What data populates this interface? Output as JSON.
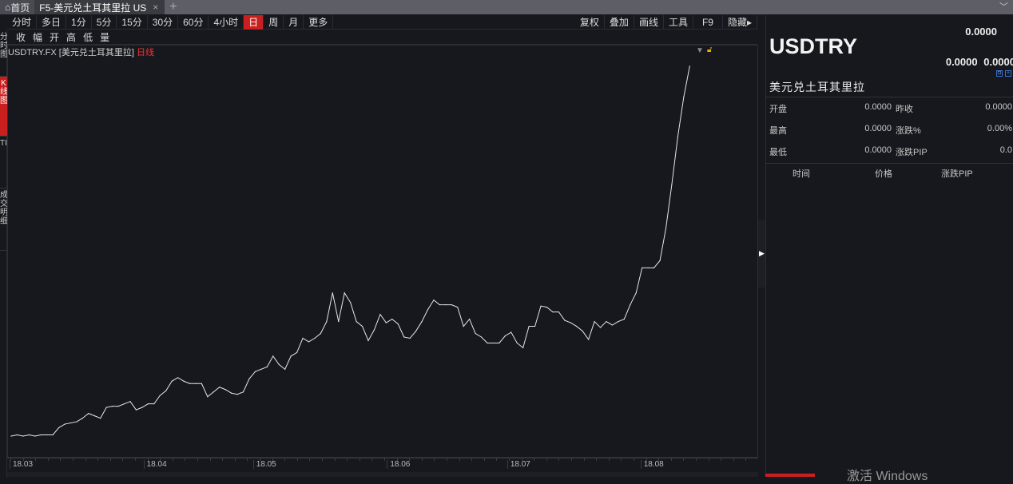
{
  "tabs": {
    "home": "首页",
    "active": "F5-美元兑土耳其里拉 US",
    "close": "×",
    "add": "+"
  },
  "toolbar": {
    "periods": [
      "分时",
      "多日",
      "1分",
      "5分",
      "15分",
      "30分",
      "60分",
      "4小时",
      "日",
      "周",
      "月",
      "更多"
    ],
    "active_period": "日",
    "right": [
      "复权",
      "叠加",
      "画线",
      "工具",
      "F9",
      "隐藏▸"
    ]
  },
  "indicators": [
    "收",
    "幅",
    "开",
    "高",
    "低",
    "量"
  ],
  "sidebar": [
    "分时图",
    "K线图",
    "TICK",
    "成交明细"
  ],
  "chart_header": {
    "symbol": "USDTRY.FX",
    "name": "[美元兑土耳其里拉]",
    "period": "日线"
  },
  "quote": {
    "symbol": "USDTRY",
    "name": "美元兑土耳其里拉",
    "last": "0.0000",
    "bid": "0.0000",
    "ask": "0.0000",
    "rows": [
      {
        "l1": "开盘",
        "v1": "0.0000",
        "l2": "昨收",
        "v2": "0.0000"
      },
      {
        "l1": "最高",
        "v1": "0.0000",
        "l2": "涨跌%",
        "v2": "0.00%"
      },
      {
        "l1": "最低",
        "v1": "0.0000",
        "l2": "涨跌PIP",
        "v2": "0.0"
      }
    ],
    "columns": [
      "时间",
      "价格",
      "涨跌PIP"
    ]
  },
  "watermark": "激活 Windows",
  "colors": {
    "accent": "#c9201f",
    "line": "#e6e6e6",
    "background": "#16181d"
  },
  "chart_data": {
    "type": "line",
    "title": "USDTRY.FX 日线",
    "xlabel": "",
    "ylabel": "",
    "ylim": [
      3.8,
      6.9
    ],
    "x_ticks": [
      {
        "index": 0,
        "label": "18.03"
      },
      {
        "index": 22.5,
        "label": "18.04"
      },
      {
        "index": 40.9,
        "label": "18.05"
      },
      {
        "index": 63.4,
        "label": "18.06"
      },
      {
        "index": 83.6,
        "label": "18.07"
      },
      {
        "index": 106,
        "label": "18.08"
      }
    ],
    "values": [
      3.8,
      3.81,
      3.8,
      3.81,
      3.8,
      3.81,
      3.81,
      3.81,
      3.87,
      3.9,
      3.91,
      3.92,
      3.95,
      3.99,
      3.97,
      3.95,
      4.04,
      4.05,
      4.05,
      4.07,
      4.09,
      4.02,
      4.04,
      4.07,
      4.07,
      4.14,
      4.18,
      4.26,
      4.29,
      4.26,
      4.24,
      4.24,
      4.24,
      4.13,
      4.17,
      4.21,
      4.19,
      4.16,
      4.15,
      4.17,
      4.28,
      4.34,
      4.36,
      4.38,
      4.47,
      4.4,
      4.36,
      4.47,
      4.5,
      4.62,
      4.59,
      4.62,
      4.66,
      4.76,
      5.0,
      4.76,
      5.0,
      4.92,
      4.76,
      4.72,
      4.6,
      4.69,
      4.82,
      4.75,
      4.78,
      4.74,
      4.63,
      4.62,
      4.68,
      4.76,
      4.86,
      4.94,
      4.9,
      4.9,
      4.9,
      4.88,
      4.72,
      4.78,
      4.66,
      4.63,
      4.58,
      4.58,
      4.58,
      4.64,
      4.67,
      4.58,
      4.54,
      4.72,
      4.72,
      4.89,
      4.88,
      4.84,
      4.84,
      4.77,
      4.75,
      4.72,
      4.68,
      4.61,
      4.76,
      4.71,
      4.76,
      4.73,
      4.76,
      4.78,
      4.9,
      5.0,
      5.21,
      5.21,
      5.21,
      5.27,
      5.54,
      5.91,
      6.31,
      6.64,
      6.9
    ]
  }
}
